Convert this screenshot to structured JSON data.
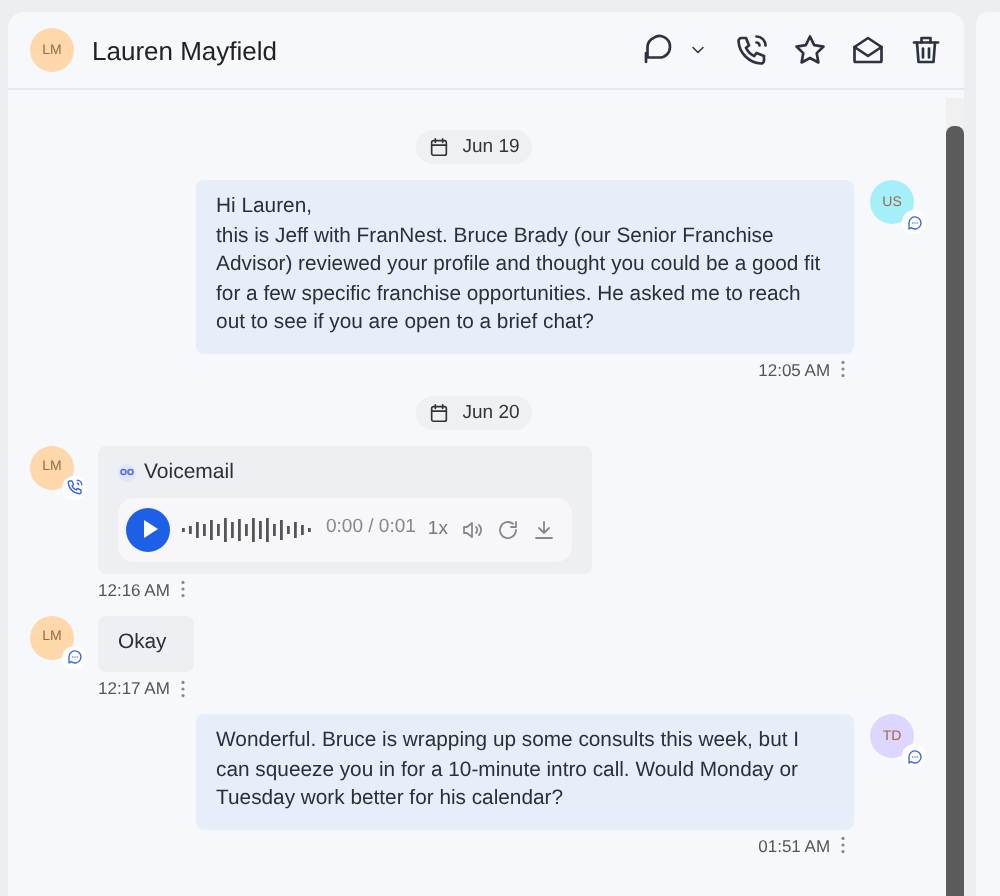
{
  "header": {
    "initials": "LM",
    "name": "Lauren Mayfield"
  },
  "timeline": [
    {
      "kind": "date",
      "label": "Jun 19"
    },
    {
      "kind": "sent",
      "avatar": {
        "initials": "US",
        "color": "#a5eff9"
      },
      "badge": {
        "kind": "chat"
      },
      "text": "Hi Lauren,\nthis is Jeff with FranNest. Bruce Brady (our Senior Franchise Advisor) reviewed your profile and thought you could be a good fit for a few specific franchise opportunities. He asked me to reach out to see if you are open to a brief chat?",
      "time": "12:05 AM"
    },
    {
      "kind": "date",
      "label": "Jun 20"
    },
    {
      "kind": "voicemail",
      "avatar": {
        "initials": "LM",
        "color": "#fed7aa"
      },
      "badge": {
        "kind": "call"
      },
      "title": "Voicemail",
      "progress": "0:00 / 0:01",
      "speed": "1x",
      "time": "12:16 AM"
    },
    {
      "kind": "received",
      "avatar": {
        "initials": "LM",
        "color": "#fed7aa"
      },
      "badge": {
        "kind": "chat"
      },
      "text": "Okay",
      "time": "12:17 AM"
    },
    {
      "kind": "sent",
      "avatar": {
        "initials": "TD",
        "color": "#ddd6fe"
      },
      "badge": {
        "kind": "chat"
      },
      "text": "Wonderful. Bruce is wrapping up some consults this week, but I can squeeze you in for a 10-minute intro call. Would Monday or Tuesday work better for his calendar?",
      "time": "01:51 AM"
    }
  ]
}
